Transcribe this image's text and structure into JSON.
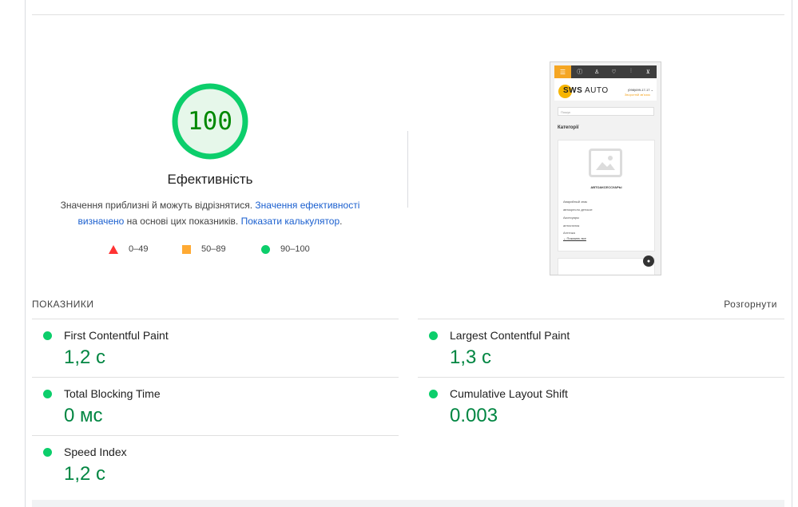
{
  "score": {
    "value": "100",
    "title": "Ефективність",
    "description_pre": "Значення приблизні й можуть відрізнятися. ",
    "link_values": "Значення ефективності визначено",
    "description_mid": " на основі цих показників. ",
    "link_calculator": "Показати калькулятор",
    "description_end": ".",
    "colors": {
      "pass": "#0cce6b",
      "pass_text": "#008800",
      "pass_bg": "#e6f7ea",
      "average": "#ffaa33",
      "fail": "#ff3333"
    }
  },
  "legend": [
    {
      "icon": "triangle-icon",
      "range": "0–49"
    },
    {
      "icon": "square-icon",
      "range": "50–89"
    },
    {
      "icon": "circle-icon",
      "range": "90–100"
    }
  ],
  "thumbnail": {
    "logo_bold": "SWS",
    "logo_regular": " AUTO",
    "phone": "(098)699-17-17 ⌄",
    "callback": "Зворотній звʼязок",
    "search_placeholder": "Пошук",
    "categories_title": "Категорії",
    "card_title": "АВТОАКСЕССУАРЫ",
    "items": [
      "Аварийный знак",
      "автокресло детское",
      "Аксесуары",
      "антистатик",
      "Аптечка"
    ],
    "more_link": "Показать все"
  },
  "metrics": {
    "title": "ПОКАЗНИКИ",
    "toggle_label": "Розгорнути",
    "items": [
      {
        "name": "First Contentful Paint",
        "value": "1,2 с"
      },
      {
        "name": "Largest Contentful Paint",
        "value": "1,3 с"
      },
      {
        "name": "Total Blocking Time",
        "value": "0 мс"
      },
      {
        "name": "Cumulative Layout Shift",
        "value": "0.003"
      },
      {
        "name": "Speed Index",
        "value": "1,2 с"
      }
    ]
  }
}
